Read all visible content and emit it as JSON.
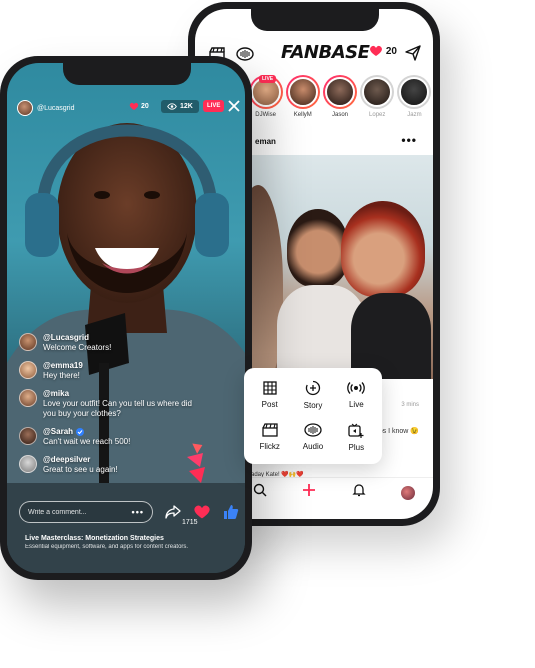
{
  "feed_app": {
    "logo": "FANBASE",
    "heart_count": "20",
    "stories": [
      {
        "name": "DJWise",
        "live": true,
        "live_label": "LIVE",
        "color": "#c7875f"
      },
      {
        "name": "KellyM",
        "live": false,
        "color": "#7a4c3a"
      },
      {
        "name": "Jason",
        "live": false,
        "color": "#3a2a22"
      },
      {
        "name": "Lopez",
        "live": false,
        "grey": true,
        "color": "#5a4a40"
      },
      {
        "name": "Jazm",
        "live": false,
        "grey": true,
        "color": "#2a2a2a"
      }
    ],
    "post": {
      "author_partial": "eman",
      "time": "3 mins",
      "caption_right": "eps I know 😉",
      "caption_left": "aday Kate! ❤️🙌❤️"
    },
    "create_menu": [
      {
        "label": "Post",
        "icon": "grid-icon"
      },
      {
        "label": "Story",
        "icon": "story-plus-icon"
      },
      {
        "label": "Live",
        "icon": "broadcast-icon"
      },
      {
        "label": "Flickz",
        "icon": "clapper-icon"
      },
      {
        "label": "Audio",
        "icon": "audio-wave-icon"
      },
      {
        "label": "Plus",
        "icon": "tv-plus-icon"
      }
    ]
  },
  "live_app": {
    "host": "@Lucasgrid",
    "likes": "20",
    "viewers": "12K",
    "live_label": "LIVE",
    "comments": [
      {
        "user": "@Lucasgrid",
        "text": "Welcome Creators!",
        "verified": false,
        "color": "#9c6a52"
      },
      {
        "user": "@emma19",
        "text": "Hey there!",
        "verified": false,
        "color": "#d9a27a"
      },
      {
        "user": "@mika",
        "text": "Love your outfit! Can you tell us where did you buy your clothes?",
        "verified": false,
        "color": "#b7866a"
      },
      {
        "user": "@Sarah",
        "text": "Can't wait we reach 500!",
        "verified": true,
        "color": "#6f4b3b"
      },
      {
        "user": "@deepsilver",
        "text": "Great to see u again!",
        "verified": false,
        "color": "#a9a9a9"
      }
    ],
    "comment_placeholder": "Write a comment...",
    "like_total": "1715",
    "footer_title": "Live Masterclass: Monetization Strategies",
    "footer_subtitle": "Essential equipment, software, and apps for content creators."
  },
  "colors": {
    "accent": "#ff2d55",
    "verified": "#2f80ff",
    "like_blue": "#3b82f6"
  }
}
